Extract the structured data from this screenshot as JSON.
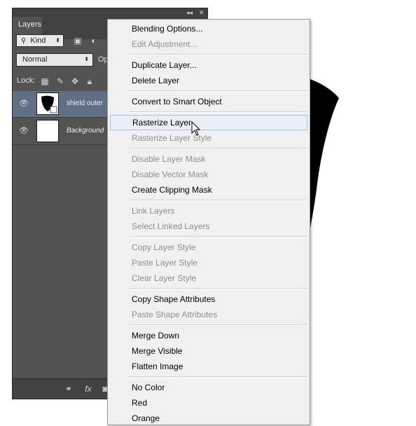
{
  "panel": {
    "tab_label": "Layers",
    "filter_kind_label": "Kind",
    "blend_mode": "Normal",
    "opacity_label_truncated": "Op",
    "lock_label": "Lock:",
    "layers": [
      {
        "name": "shield outer",
        "selected": true
      },
      {
        "name": "Background",
        "selected": false
      }
    ],
    "footer_fx_label": "fx"
  },
  "menu": {
    "items": [
      {
        "label": "Blending Options...",
        "enabled": true
      },
      {
        "label": "Edit Adjustment...",
        "enabled": false
      },
      {
        "label": "Duplicate Layer...",
        "enabled": true
      },
      {
        "label": "Delete Layer",
        "enabled": true
      },
      {
        "label": "Convert to Smart Object",
        "enabled": true
      },
      {
        "label": "Rasterize Layer",
        "enabled": true,
        "highlighted": true
      },
      {
        "label": "Rasterize Layer Style",
        "enabled": false
      },
      {
        "label": "Disable Layer Mask",
        "enabled": false
      },
      {
        "label": "Disable Vector Mask",
        "enabled": false
      },
      {
        "label": "Create Clipping Mask",
        "enabled": true
      },
      {
        "label": "Link Layers",
        "enabled": false
      },
      {
        "label": "Select Linked Layers",
        "enabled": false
      },
      {
        "label": "Copy Layer Style",
        "enabled": false
      },
      {
        "label": "Paste Layer Style",
        "enabled": false
      },
      {
        "label": "Clear Layer Style",
        "enabled": false
      },
      {
        "label": "Copy Shape Attributes",
        "enabled": true
      },
      {
        "label": "Paste Shape Attributes",
        "enabled": false
      },
      {
        "label": "Merge Down",
        "enabled": true
      },
      {
        "label": "Merge Visible",
        "enabled": true
      },
      {
        "label": "Flatten Image",
        "enabled": true
      },
      {
        "label": "No Color",
        "enabled": true
      },
      {
        "label": "Red",
        "enabled": true
      },
      {
        "label": "Orange",
        "enabled": true
      }
    ]
  },
  "colors": {
    "panel_bg": "#535353",
    "selected_layer": "#5f6f86",
    "menu_bg": "#f0f0f0",
    "menu_highlight": "#e8eff8"
  }
}
